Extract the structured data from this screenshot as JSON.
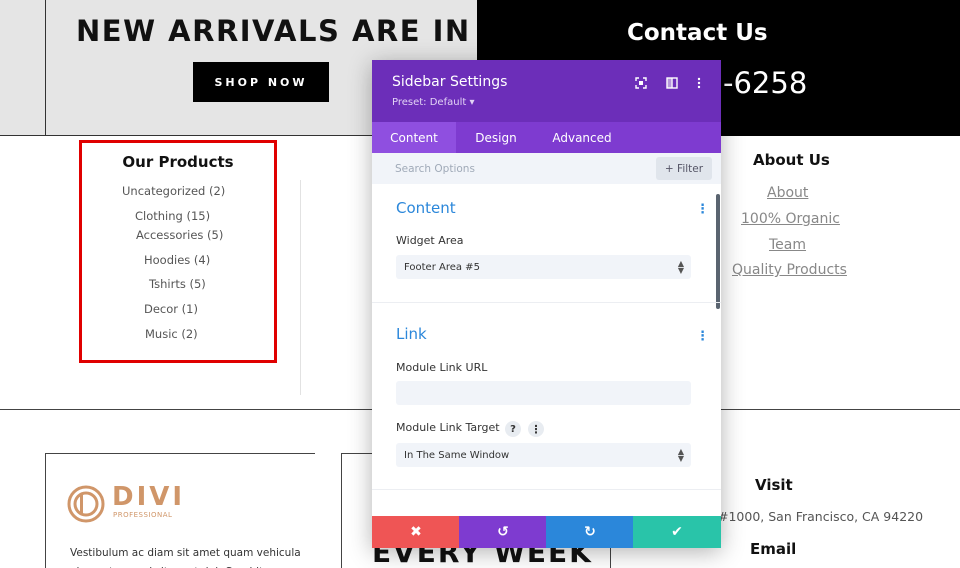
{
  "banner": {
    "title": "NEW ARRIVALS ARE IN",
    "shop_label": "SHOP NOW",
    "contact_title": "Contact Us",
    "contact_phone_visible": "-6258"
  },
  "products": {
    "title": "Our Products",
    "items": [
      {
        "label": "Uncategorized (2)"
      },
      {
        "label": "Clothing (15)"
      },
      {
        "label": "Accessories (5)"
      },
      {
        "label": "Hoodies (4)"
      },
      {
        "label": "Tshirts (5)"
      },
      {
        "label": "Decor (1)"
      },
      {
        "label": "Music (2)"
      }
    ],
    "highlight_color": "#e00000"
  },
  "about": {
    "title": "About Us",
    "links": [
      {
        "label": "About"
      },
      {
        "label": "100% Organic"
      },
      {
        "label": "Team"
      },
      {
        "label": "Quality Products"
      }
    ]
  },
  "footer": {
    "logo_word": "DIVI",
    "logo_sub": "PROFESSIONAL",
    "brand_color": "#d09669",
    "card_text": "Vestibulum ac diam sit amet quam vehicula elementum sed sit amet dui. Curabitur arcu",
    "every_week": "EVERY WEEK",
    "visit_title": "Visit",
    "visit_address": "#1000, San Francisco, CA 94220",
    "email_title": "Email"
  },
  "modal": {
    "title": "Sidebar Settings",
    "preset": "Preset: Default ▾",
    "header_icons": [
      "expand-icon",
      "split-view-icon",
      "more-vertical-icon"
    ],
    "tabs": [
      {
        "label": "Content",
        "active": true
      },
      {
        "label": "Design",
        "active": false
      },
      {
        "label": "Advanced",
        "active": false
      }
    ],
    "search_placeholder": "Search Options",
    "filter_label": "+ Filter",
    "sections": {
      "content": {
        "title": "Content",
        "widget_area_label": "Widget Area",
        "widget_area_value": "Footer Area #5"
      },
      "link": {
        "title": "Link",
        "url_label": "Module Link URL",
        "url_value": "",
        "target_label": "Module Link Target",
        "target_value": "In The Same Window"
      }
    },
    "footer_buttons": [
      {
        "name": "discard",
        "symbol": "✖",
        "color": "#ef5555"
      },
      {
        "name": "undo",
        "symbol": "↺",
        "color": "#7e3bd0"
      },
      {
        "name": "redo",
        "symbol": "↻",
        "color": "#2b87da"
      },
      {
        "name": "save",
        "symbol": "✔",
        "color": "#29c4a9"
      }
    ],
    "header_color": "#6c2eb9",
    "tab_bar_color": "#7e3bd0",
    "accent_color": "#2b87da"
  }
}
